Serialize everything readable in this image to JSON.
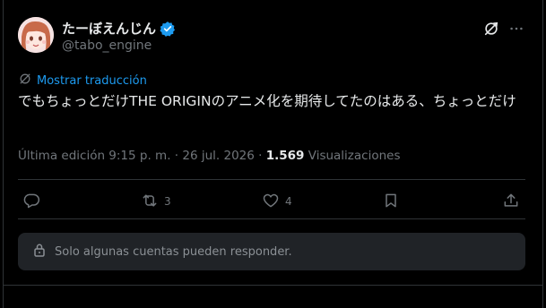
{
  "author": {
    "display_name": "たーぼえんじん",
    "handle": "@tabo_engine",
    "verified_color": "#1d9bf0"
  },
  "icons": {
    "grok": "grok-icon",
    "more": "more-options-icon",
    "translate": "translate-icon",
    "reply": "reply-icon",
    "repost": "repost-icon",
    "like": "like-icon",
    "bookmark": "bookmark-icon",
    "share": "share-icon",
    "lock": "lock-icon"
  },
  "translate_label": "Mostrar traducción",
  "tweet_text": "でもちょっとだけTHE ORIGINのアニメ化を期待してたのはある、ちょっとだけ",
  "meta": {
    "edited": "Última edición 9:15 p. m.",
    "separator": "·",
    "date": "26 jul. 2026",
    "views_count": "1.569",
    "views_label": "Visualizaciones"
  },
  "actions": {
    "reposts": "3",
    "likes": "4"
  },
  "reply_restriction": "Solo algunas cuentas pueden responder.",
  "colors": {
    "background": "#000000",
    "text": "#e7e9ea",
    "secondary": "#71767b",
    "accent": "#1d9bf0",
    "divider": "#2f3336",
    "reply_box": "#202327"
  }
}
